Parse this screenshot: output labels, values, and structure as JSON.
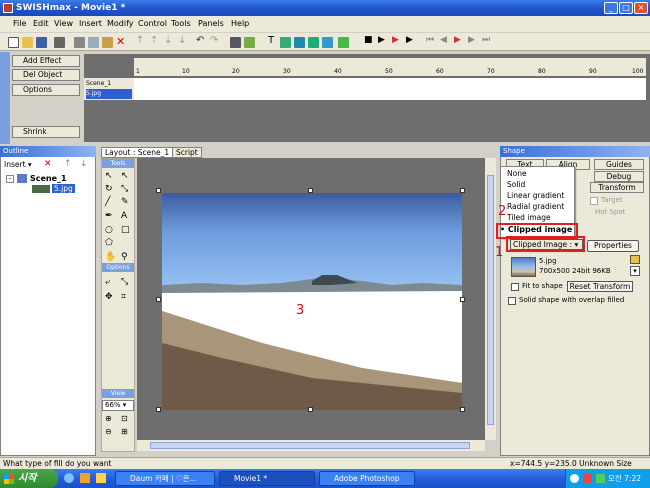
{
  "window": {
    "title": "SWISHmax - Movie1 *"
  },
  "menu": [
    "File",
    "Edit",
    "View",
    "Insert",
    "Modify",
    "Control",
    "Tools",
    "Panels",
    "Help"
  ],
  "timeline": {
    "buttons": [
      "Add Effect",
      "Del Object",
      "Options",
      "Shrink"
    ],
    "ruler_labels": [
      "1",
      "10",
      "20",
      "30",
      "40",
      "50",
      "60",
      "70",
      "80",
      "90",
      "100"
    ],
    "layers": [
      "Scene_1",
      "5.jpg"
    ]
  },
  "outline": {
    "title": "Outline",
    "insert_label": "Insert",
    "scene": "Scene_1",
    "object": "5.jpg"
  },
  "layout": {
    "tabs": [
      "Layout : Scene_1",
      "Script"
    ],
    "tools_label": "Tools",
    "options_label": "Options",
    "view_label": "View",
    "zoom": "66%"
  },
  "shape": {
    "title": "Shape",
    "tabs": [
      "Text",
      "Align",
      "Guides",
      "Debug",
      "Transform"
    ],
    "target_label": "Target",
    "hotspot_label": "Hot Spot",
    "fill_options": [
      "None",
      "Solid",
      "Linear gradient",
      "Radial gradient",
      "Tiled image",
      "Clipped image"
    ],
    "selected_fill": "Clipped image",
    "dropdown_value": "Clipped Image :",
    "properties_button": "Properties",
    "image_name": "5.jpg",
    "image_info": "700x500 24bit 96KB",
    "fit_to_shape": "Fit to shape",
    "reset_transform": "Reset Transform",
    "solid_overlap": "Solid shape with overlap filled"
  },
  "annotations": {
    "a1": "1",
    "a2": "2",
    "a3": "3"
  },
  "status": {
    "left": "What type of fill do you want",
    "right": "x=744.5 y=235.0  Unknown Size"
  },
  "taskbar": {
    "start": "시작",
    "tasks": [
      "Daum 카페 | ♡은...",
      "Movie1 *",
      "Adobe Photoshop"
    ],
    "clock": "오전 7:22"
  }
}
